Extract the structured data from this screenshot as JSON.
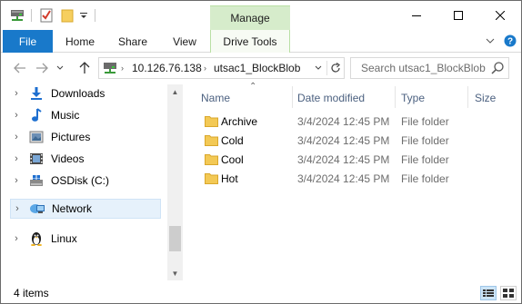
{
  "ribbon": {
    "contextual_group": "Manage",
    "tabs": [
      {
        "label": "File"
      },
      {
        "label": "Home"
      },
      {
        "label": "Share"
      },
      {
        "label": "View"
      },
      {
        "label": "Drive Tools"
      }
    ]
  },
  "address": {
    "parts": [
      "10.126.76.138",
      "utsac1_BlockBlob"
    ],
    "search_placeholder": "Search utsac1_BlockBlob"
  },
  "nav": {
    "items": [
      {
        "label": "Downloads",
        "icon": "download-arrow-icon"
      },
      {
        "label": "Music",
        "icon": "music-note-icon"
      },
      {
        "label": "Pictures",
        "icon": "pictures-icon"
      },
      {
        "label": "Videos",
        "icon": "film-icon"
      },
      {
        "label": "OSDisk (C:)",
        "icon": "windows-drive-icon"
      },
      {
        "label": "Network",
        "icon": "network-icon",
        "selected": true
      },
      {
        "label": "Linux",
        "icon": "linux-penguin-icon"
      }
    ]
  },
  "columns": {
    "name": "Name",
    "date": "Date modified",
    "type": "Type",
    "size": "Size"
  },
  "files": [
    {
      "name": "Archive",
      "date": "3/4/2024 12:45 PM",
      "type": "File folder"
    },
    {
      "name": "Cold",
      "date": "3/4/2024 12:45 PM",
      "type": "File folder"
    },
    {
      "name": "Cool",
      "date": "3/4/2024 12:45 PM",
      "type": "File folder"
    },
    {
      "name": "Hot",
      "date": "3/4/2024 12:45 PM",
      "type": "File folder"
    }
  ],
  "status": {
    "item_count": "4 items"
  },
  "colors": {
    "file_tab": "#1979ca",
    "manage_header": "#d6eccb",
    "selection": "#e6f1fb",
    "folder": "#f3c955"
  }
}
